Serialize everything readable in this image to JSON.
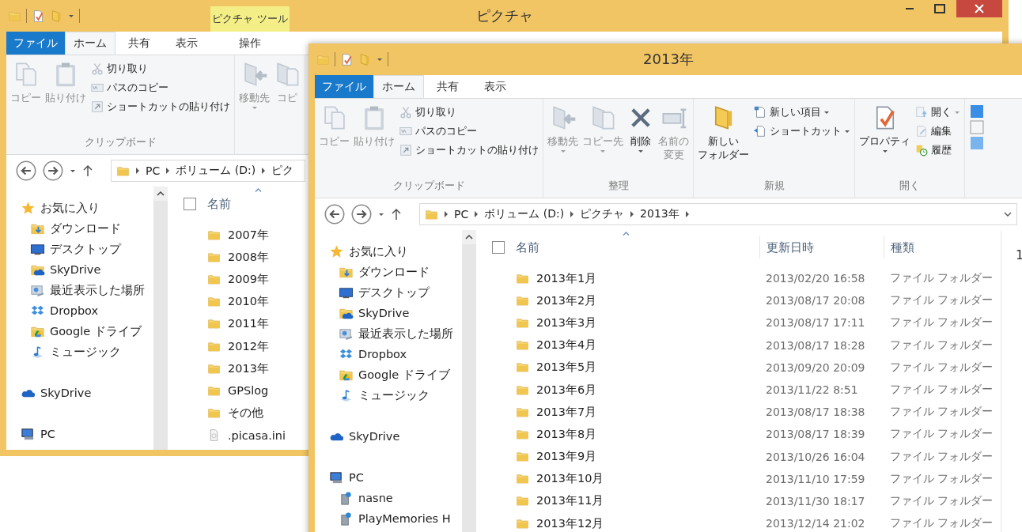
{
  "back_window": {
    "title": "ピクチャ",
    "context_tab": "ピクチャ ツール",
    "tabs": [
      {
        "label": "ファイル",
        "kind": "file",
        "selected": false
      },
      {
        "label": "ホーム",
        "kind": "normal",
        "selected": true
      },
      {
        "label": "共有",
        "kind": "normal",
        "selected": false
      },
      {
        "label": "表示",
        "kind": "normal",
        "selected": false
      },
      {
        "label": "操作",
        "kind": "context",
        "selected": false
      }
    ],
    "ribbon": [
      {
        "label": "クリップボード",
        "large": [
          {
            "label": "コピー",
            "kind": "copy",
            "disabled": true
          },
          {
            "label": "貼り付け",
            "kind": "paste",
            "disabled": true
          }
        ],
        "small": [
          {
            "label": "切り取り",
            "kind": "cut",
            "disabled": true
          },
          {
            "label": "パスのコピー",
            "kind": "path",
            "disabled": true
          },
          {
            "label": "ショートカットの貼り付け",
            "kind": "shortcut",
            "disabled": true
          }
        ]
      },
      {
        "large": [
          {
            "label": "移動先",
            "kind": "move",
            "disabled": true,
            "menu": true
          },
          {
            "label": "コピ",
            "kind": "copy-to",
            "disabled": true
          }
        ]
      }
    ],
    "address": [
      "PC",
      "ボリューム (D:)",
      "ピク"
    ],
    "nav": [
      {
        "label": "お気に入り",
        "kind": "star",
        "children": [
          {
            "label": "ダウンロード",
            "kind": "download"
          },
          {
            "label": "デスクトップ",
            "kind": "desktop"
          },
          {
            "label": "SkyDrive",
            "kind": "cloud-folder"
          },
          {
            "label": "最近表示した場所",
            "kind": "recent"
          },
          {
            "label": "Dropbox",
            "kind": "dropbox"
          },
          {
            "label": "Google ドライブ",
            "kind": "drive-folder"
          },
          {
            "label": "ミュージック",
            "kind": "music"
          }
        ]
      },
      {
        "label": "SkyDrive",
        "kind": "cloud"
      },
      {
        "label": "PC",
        "kind": "pc"
      }
    ],
    "list": {
      "select_all_checked": false,
      "columns": [
        "名前"
      ],
      "rows": [
        {
          "name": "2007年",
          "kind": "folder"
        },
        {
          "name": "2008年",
          "kind": "folder"
        },
        {
          "name": "2009年",
          "kind": "folder"
        },
        {
          "name": "2010年",
          "kind": "folder"
        },
        {
          "name": "2011年",
          "kind": "folder"
        },
        {
          "name": "2012年",
          "kind": "folder"
        },
        {
          "name": "2013年",
          "kind": "folder"
        },
        {
          "name": "GPSlog",
          "kind": "folder"
        },
        {
          "name": "その他",
          "kind": "folder"
        },
        {
          "name": ".picasa.ini",
          "kind": "file"
        }
      ]
    }
  },
  "front_window": {
    "title": "2013年",
    "tabs": [
      {
        "label": "ファイル",
        "kind": "file",
        "selected": false
      },
      {
        "label": "ホーム",
        "kind": "normal",
        "selected": true
      },
      {
        "label": "共有",
        "kind": "normal",
        "selected": false
      },
      {
        "label": "表示",
        "kind": "normal",
        "selected": false
      }
    ],
    "ribbon": [
      {
        "label": "クリップボード",
        "large": [
          {
            "label": "コピー",
            "kind": "copy",
            "disabled": true
          },
          {
            "label": "貼り付け",
            "kind": "paste",
            "disabled": true
          }
        ],
        "small": [
          {
            "label": "切り取り",
            "kind": "cut",
            "disabled": true
          },
          {
            "label": "パスのコピー",
            "kind": "path",
            "disabled": true
          },
          {
            "label": "ショートカットの貼り付け",
            "kind": "shortcut",
            "disabled": true
          }
        ]
      },
      {
        "label": "整理",
        "large": [
          {
            "label": "移動先",
            "kind": "move",
            "disabled": true,
            "menu": true
          },
          {
            "label": "コピー先",
            "kind": "copy-to",
            "disabled": true,
            "menu": true
          },
          {
            "label": "削除",
            "kind": "delete",
            "disabled": false,
            "menu": true
          },
          {
            "label": [
              "名前の",
              "変更"
            ],
            "kind": "rename",
            "disabled": true
          }
        ]
      },
      {
        "label": "新規",
        "large": [
          {
            "label": [
              "新しい",
              "フォルダー"
            ],
            "kind": "new-folder",
            "disabled": false
          }
        ],
        "small": [
          {
            "label": "新しい項目",
            "kind": "new-item",
            "disabled": false,
            "menu": true
          },
          {
            "label": "ショートカット",
            "kind": "new-shortcut",
            "disabled": false,
            "menu": true
          }
        ]
      },
      {
        "label": "開く",
        "large": [
          {
            "label": "プロパティ",
            "kind": "properties",
            "disabled": false,
            "menu": true
          }
        ],
        "small": [
          {
            "label": "開く",
            "kind": "open",
            "disabled": true,
            "menu": true
          },
          {
            "label": "編集",
            "kind": "edit",
            "disabled": true
          },
          {
            "label": "履歴",
            "kind": "history",
            "disabled": false
          }
        ]
      }
    ],
    "address": [
      "PC",
      "ボリューム (D:)",
      "ピクチャ",
      "2013年"
    ],
    "nav": [
      {
        "label": "お気に入り",
        "kind": "star",
        "children": [
          {
            "label": "ダウンロード",
            "kind": "download"
          },
          {
            "label": "デスクトップ",
            "kind": "desktop"
          },
          {
            "label": "SkyDrive",
            "kind": "cloud-folder"
          },
          {
            "label": "最近表示した場所",
            "kind": "recent"
          },
          {
            "label": "Dropbox",
            "kind": "dropbox"
          },
          {
            "label": "Google ドライブ",
            "kind": "drive-folder"
          },
          {
            "label": "ミュージック",
            "kind": "music"
          }
        ]
      },
      {
        "label": "SkyDrive",
        "kind": "cloud"
      },
      {
        "label": "PC",
        "kind": "pc",
        "children": [
          {
            "label": "nasne",
            "kind": "device"
          },
          {
            "label": "PlayMemories H",
            "kind": "device"
          }
        ]
      }
    ],
    "list": {
      "select_all_checked": false,
      "columns": [
        "名前",
        "更新日時",
        "種類"
      ],
      "rows": [
        {
          "name": "2013年1月",
          "kind": "folder",
          "modified": "2013/02/20 16:58",
          "type": "ファイル フォルダー"
        },
        {
          "name": "2013年2月",
          "kind": "folder",
          "modified": "2013/08/17 20:08",
          "type": "ファイル フォルダー"
        },
        {
          "name": "2013年3月",
          "kind": "folder",
          "modified": "2013/08/17 17:11",
          "type": "ファイル フォルダー"
        },
        {
          "name": "2013年4月",
          "kind": "folder",
          "modified": "2013/08/17 18:28",
          "type": "ファイル フォルダー"
        },
        {
          "name": "2013年5月",
          "kind": "folder",
          "modified": "2013/09/20 20:09",
          "type": "ファイル フォルダー"
        },
        {
          "name": "2013年6月",
          "kind": "folder",
          "modified": "2013/11/22 8:51",
          "type": "ファイル フォルダー"
        },
        {
          "name": "2013年7月",
          "kind": "folder",
          "modified": "2013/08/17 18:38",
          "type": "ファイル フォルダー"
        },
        {
          "name": "2013年8月",
          "kind": "folder",
          "modified": "2013/08/17 18:39",
          "type": "ファイル フォルダー"
        },
        {
          "name": "2013年9月",
          "kind": "folder",
          "modified": "2013/10/26 16:04",
          "type": "ファイル フォルダー"
        },
        {
          "name": "2013年10月",
          "kind": "folder",
          "modified": "2013/11/10 17:59",
          "type": "ファイル フォルダー"
        },
        {
          "name": "2013年11月",
          "kind": "folder",
          "modified": "2013/11/30 18:17",
          "type": "ファイル フォルダー"
        },
        {
          "name": "2013年12月",
          "kind": "folder",
          "modified": "2013/12/14 21:02",
          "type": "ファイル フォルダー"
        }
      ]
    },
    "preview_text": "1"
  }
}
